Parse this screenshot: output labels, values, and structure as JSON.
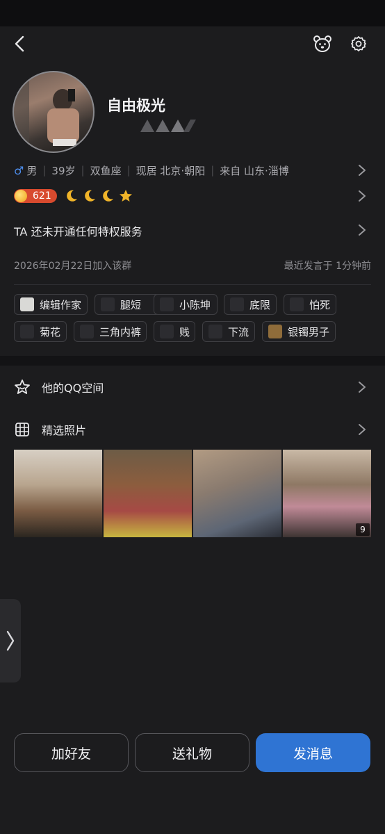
{
  "header": {
    "back_icon": "chevron-left-icon",
    "bear_icon": "bear-icon",
    "settings_icon": "gear-icon"
  },
  "profile": {
    "nickname": "自由极光",
    "gender": "男",
    "age": "39岁",
    "zodiac": "双鱼座",
    "location": "现居 北京·朝阳",
    "hometown": "来自 山东·淄博",
    "level": "621",
    "level_icons": [
      "moon",
      "moon",
      "moon",
      "star"
    ]
  },
  "privilege": {
    "text": "TA 还未开通任何特权服务"
  },
  "group": {
    "joined": "2026年02月22日加入该群",
    "last_spoke": "最近发言于 1分钟前"
  },
  "tags": [
    {
      "label": "编辑作家"
    },
    {
      "label": "腿短"
    },
    {
      "label": "小陈坤"
    },
    {
      "label": "底限"
    },
    {
      "label": "怕死"
    },
    {
      "label": "菊花"
    },
    {
      "label": "三角内裤"
    },
    {
      "label": "贱"
    },
    {
      "label": "下流"
    },
    {
      "label": "银镯男子"
    }
  ],
  "qzone": {
    "label": "他的QQ空间"
  },
  "photos": {
    "label": "精选照片",
    "count": "9"
  },
  "actions": {
    "add_friend": "加好友",
    "send_gift": "送礼物",
    "send_message": "发消息"
  },
  "colors": {
    "background": "#1c1c1e",
    "primary_button": "#2f74d3",
    "level_badge": "#d84a2e",
    "moon": "#f0b429"
  }
}
